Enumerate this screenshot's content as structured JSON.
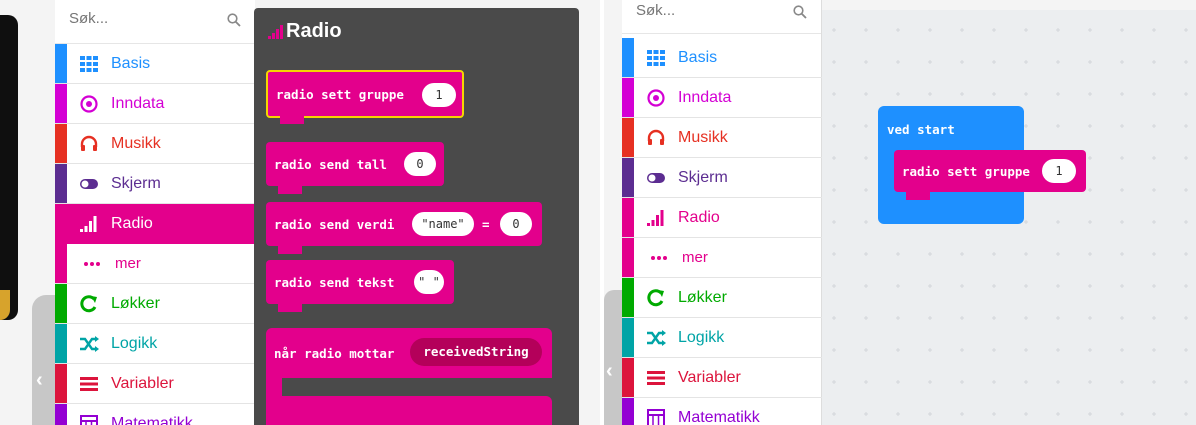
{
  "search": {
    "placeholder": "Søk..."
  },
  "categories": [
    {
      "label": "Basis",
      "color": "#1e90ff",
      "icon": "grid-icon"
    },
    {
      "label": "Inndata",
      "color": "#d400d4",
      "icon": "target-icon"
    },
    {
      "label": "Musikk",
      "color": "#e63022",
      "icon": "headphones-icon"
    },
    {
      "label": "Skjerm",
      "color": "#5c2d91",
      "icon": "toggle-icon"
    },
    {
      "label": "Radio",
      "color": "#e3008c",
      "icon": "signal-icon"
    },
    {
      "label": "mer",
      "color": "#e3008c",
      "icon": "dots-icon"
    },
    {
      "label": "Løkker",
      "color": "#00aa00",
      "icon": "loop-icon"
    },
    {
      "label": "Logikk",
      "color": "#00a4a6",
      "icon": "shuffle-icon"
    },
    {
      "label": "Variabler",
      "color": "#dc143c",
      "icon": "list-icon"
    },
    {
      "label": "Matematikk",
      "color": "#9400d3",
      "icon": "calculator-icon"
    }
  ],
  "flyout": {
    "title": "Radio",
    "blocks": {
      "set_group": {
        "label": "radio sett gruppe",
        "value": "1"
      },
      "send_number": {
        "label": "radio send tall",
        "value": "0"
      },
      "send_value": {
        "label": "radio send verdi",
        "name": "\"name\"",
        "eq": "=",
        "value": "0"
      },
      "send_string": {
        "label": "radio send tekst",
        "value": "\" \""
      },
      "on_received": {
        "label": "når radio mottar",
        "var": "receivedString"
      }
    }
  },
  "workspace": {
    "on_start": {
      "label": "ved start"
    },
    "set_group": {
      "label": "radio sett gruppe",
      "value": "1"
    }
  }
}
